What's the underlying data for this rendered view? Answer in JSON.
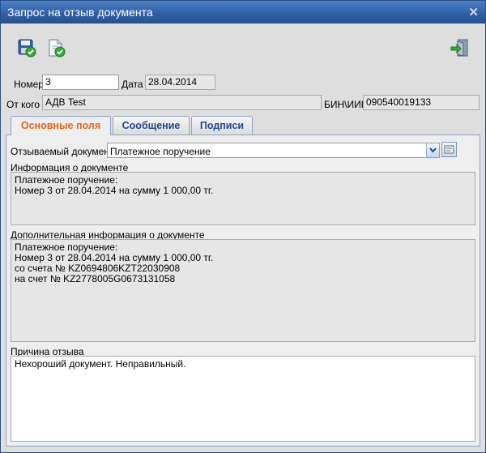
{
  "window": {
    "title": "Запрос на отзыв документа"
  },
  "toolbar": {
    "save_icon": "save-check-icon",
    "verify_icon": "document-check-icon",
    "exit_icon": "exit-door-icon"
  },
  "form": {
    "number_label": "Номер",
    "number_value": "3",
    "date_label": "Дата",
    "date_value": "28.04.2014",
    "from_label": "От кого",
    "from_value": "АДВ Test",
    "bin_label": "БИН\\ИИН",
    "bin_value": "090540019133"
  },
  "tabs": [
    {
      "label": "Основные поля",
      "active": true
    },
    {
      "label": "Сообщение",
      "active": false
    },
    {
      "label": "Подписи",
      "active": false
    }
  ],
  "main": {
    "recalled_doc_label": "Отзываемый документ",
    "recalled_doc_value": "Платежное поручение",
    "doc_info_label": "Информация о документе",
    "doc_info_text": "Платежное поручение:\nНомер 3 от 28.04.2014 на сумму 1 000,00 тг.",
    "extra_info_label": "Дополнительная информация о документе",
    "extra_info_text": "Платежное поручение:\nНомер 3 от 28.04.2014 на сумму 1 000,00 тг.\nсо счета № KZ0694806KZT22030908\nна счет № KZ2778005G0673131058",
    "reason_label": "Причина отзыва",
    "reason_text": "Нехороший документ. Неправильный."
  },
  "colors": {
    "title_bar": "#2e5da4",
    "active_tab": "#e8641a",
    "tab_text": "#1d4a94"
  }
}
